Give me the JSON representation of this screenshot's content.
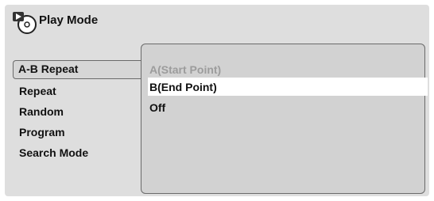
{
  "header": {
    "title": "Play Mode",
    "icon": "disc-play-icon"
  },
  "menu": {
    "items": [
      {
        "label": "A-B Repeat",
        "selected": true
      },
      {
        "label": "Repeat",
        "selected": false
      },
      {
        "label": "Random",
        "selected": false
      },
      {
        "label": "Program",
        "selected": false
      },
      {
        "label": "Search Mode",
        "selected": false
      }
    ]
  },
  "submenu": {
    "options": [
      {
        "label": "A(Start Point)",
        "state": "disabled"
      },
      {
        "label": "B(End Point)",
        "state": "highlighted"
      },
      {
        "label": "Off",
        "state": "normal"
      }
    ]
  },
  "colors": {
    "background": "#dedede",
    "panel": "#d2d2d2",
    "highlight": "#ffffff",
    "disabled_text": "#9c9c9c"
  }
}
